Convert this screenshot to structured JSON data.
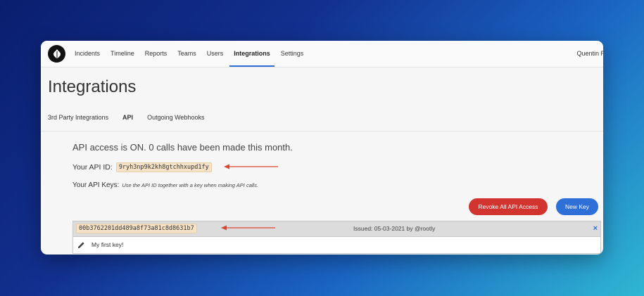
{
  "nav": {
    "items": [
      {
        "label": "Incidents"
      },
      {
        "label": "Timeline"
      },
      {
        "label": "Reports"
      },
      {
        "label": "Teams"
      },
      {
        "label": "Users"
      },
      {
        "label": "Integrations"
      },
      {
        "label": "Settings"
      }
    ],
    "active": "Integrations",
    "user_name": "Quentin Ro"
  },
  "page": {
    "title": "Integrations",
    "tabs": [
      {
        "label": "3rd Party Integrations"
      },
      {
        "label": "API"
      },
      {
        "label": "Outgoing Webhooks"
      }
    ],
    "active_tab": "API"
  },
  "api": {
    "status_text": "API access is ON. 0 calls have been made this month.",
    "id_label": "Your API ID:",
    "id_value": "9ryh3np9k2kh8gtchhxupd1fy",
    "keys_label": "Your API Keys:",
    "keys_hint": "Use the API ID together with a key when making API calls.",
    "revoke_label": "Revoke All API Access",
    "new_key_label": "New Key"
  },
  "keys": [
    {
      "value": "00b3762201dd489a8f73a81c8d8631b7",
      "issued": "Issued: 05-03-2021 by @rootly",
      "name": "My first key!",
      "close_glyph": "×"
    }
  ],
  "colors": {
    "accent": "#2f6fd8",
    "danger": "#d2342f",
    "arrow": "#d9452f",
    "chip_bg": "#f6e3c7"
  },
  "icons": [
    "rootly-logo-icon",
    "arrow-icon",
    "close-icon",
    "pencil-icon"
  ]
}
